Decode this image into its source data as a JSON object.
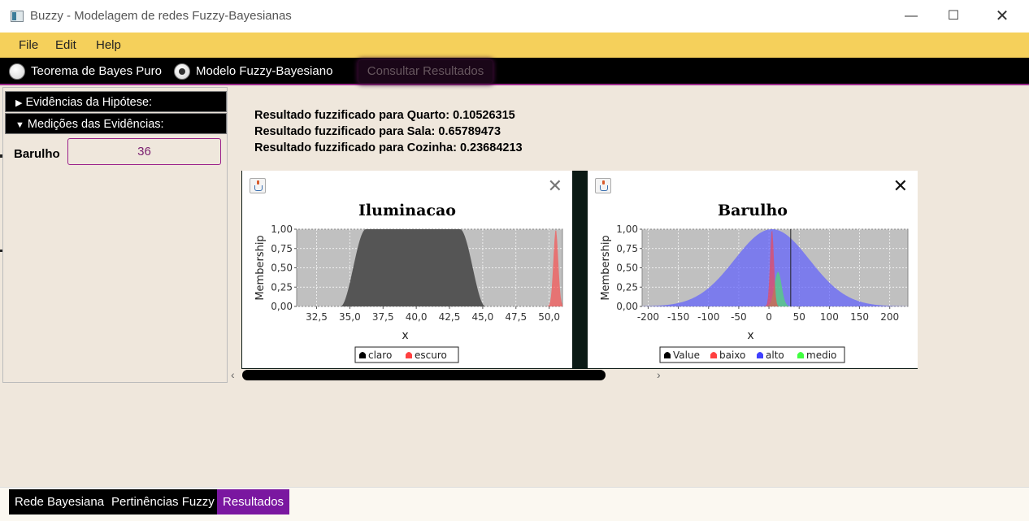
{
  "window": {
    "title": "Buzzy - Modelagem de redes Fuzzy-Bayesianas",
    "min_glyph": "—",
    "max_glyph": "☐",
    "close_glyph": "✕"
  },
  "menu": [
    "File",
    "Edit",
    "Help"
  ],
  "toolbar": {
    "radio_options": [
      {
        "label": "Teorema de Bayes Puro",
        "selected": false
      },
      {
        "label": "Modelo Fuzzy-Bayesiano",
        "selected": true
      }
    ],
    "consult_button": "Consultar Resultados"
  },
  "sidebar": {
    "sections": [
      {
        "label": "Evidências da Hipótese:",
        "expanded": false
      },
      {
        "label": "Medições das Evidências:",
        "expanded": true
      }
    ],
    "field": {
      "label": "Barulho",
      "value": "36"
    }
  },
  "results": [
    "Resultado fuzzificado para Quarto: 0.10526315",
    "Resultado fuzzificado para Sala: 0.65789473",
    "Resultado fuzzificado para Cozinha: 0.23684213"
  ],
  "colors": {
    "accent": "#9b1f8a",
    "menubar": "#f5d05b",
    "active_tab": "#7a17a0"
  },
  "charts": [
    {
      "title": "Iluminacao",
      "ylabel": "Membership",
      "xlabel": "x",
      "xlim": [
        31,
        51
      ],
      "ylim": [
        0,
        1
      ],
      "xticks": [
        "32,5",
        "35,0",
        "37,5",
        "40,0",
        "42,5",
        "45,0",
        "47,5",
        "50,0"
      ],
      "yticks": [
        "0,00",
        "0,25",
        "0,50",
        "0,75",
        "1,00"
      ],
      "legend": [
        {
          "name": "claro",
          "color": "#000000"
        },
        {
          "name": "escuro",
          "color": "#ff4040"
        }
      ]
    },
    {
      "title": "Barulho",
      "ylabel": "Membership",
      "xlabel": "x",
      "xlim": [
        -210,
        230
      ],
      "ylim": [
        0,
        1
      ],
      "xticks": [
        "-200",
        "-150",
        "-100",
        "-50",
        "0",
        "50",
        "100",
        "150",
        "200"
      ],
      "yticks": [
        "0,00",
        "0,25",
        "0,50",
        "0,75",
        "1,00"
      ],
      "marker_value": 36,
      "legend": [
        {
          "name": "Value",
          "color": "#000000"
        },
        {
          "name": "baixo",
          "color": "#ff4040"
        },
        {
          "name": "alto",
          "color": "#4040ff"
        },
        {
          "name": "medio",
          "color": "#40ff40"
        }
      ]
    }
  ],
  "scroll": {
    "left_glyph": "‹",
    "right_glyph": "›"
  },
  "tabs": [
    {
      "label": "Rede Bayesiana",
      "active": false
    },
    {
      "label": "Pertinências Fuzzy",
      "active": false
    },
    {
      "label": "Resultados",
      "active": true
    }
  ]
}
